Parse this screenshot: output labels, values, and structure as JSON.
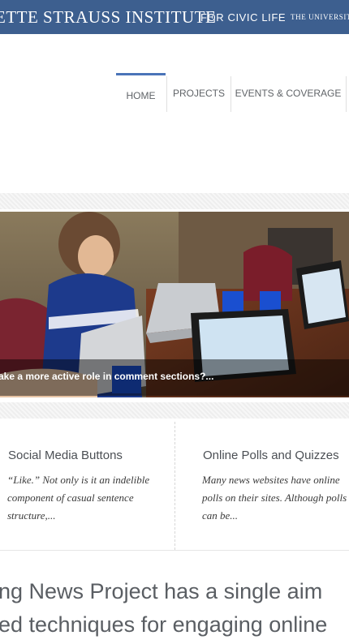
{
  "header": {
    "brand_main": "ETTE STRAUSS INSTITUTE",
    "brand_sub": "FOR CIVIC LIFE",
    "brand_university": "THE UNIVERSITY"
  },
  "nav": {
    "items": [
      {
        "label": "HOME",
        "active": true
      },
      {
        "label": "PROJECTS",
        "active": false
      },
      {
        "label": "EVENTS & COVERAGE",
        "active": false
      }
    ]
  },
  "slider": {
    "caption": "ake a more active role in comment sections?..."
  },
  "cards": [
    {
      "title": "Social Media Buttons",
      "excerpt": "“Like.”  Not only is it an indelible component of casual sentence structure,..."
    },
    {
      "title": "Online Polls and Quizzes",
      "excerpt": "Many news websites have online polls on their sites. Although polls can be..."
    }
  ],
  "intro": {
    "line1": "ng News Project has a single aim",
    "line2": "ed techniques for engaging online"
  },
  "colors": {
    "header_bg": "#3d5f8f",
    "nav_active": "#4a74b8"
  }
}
